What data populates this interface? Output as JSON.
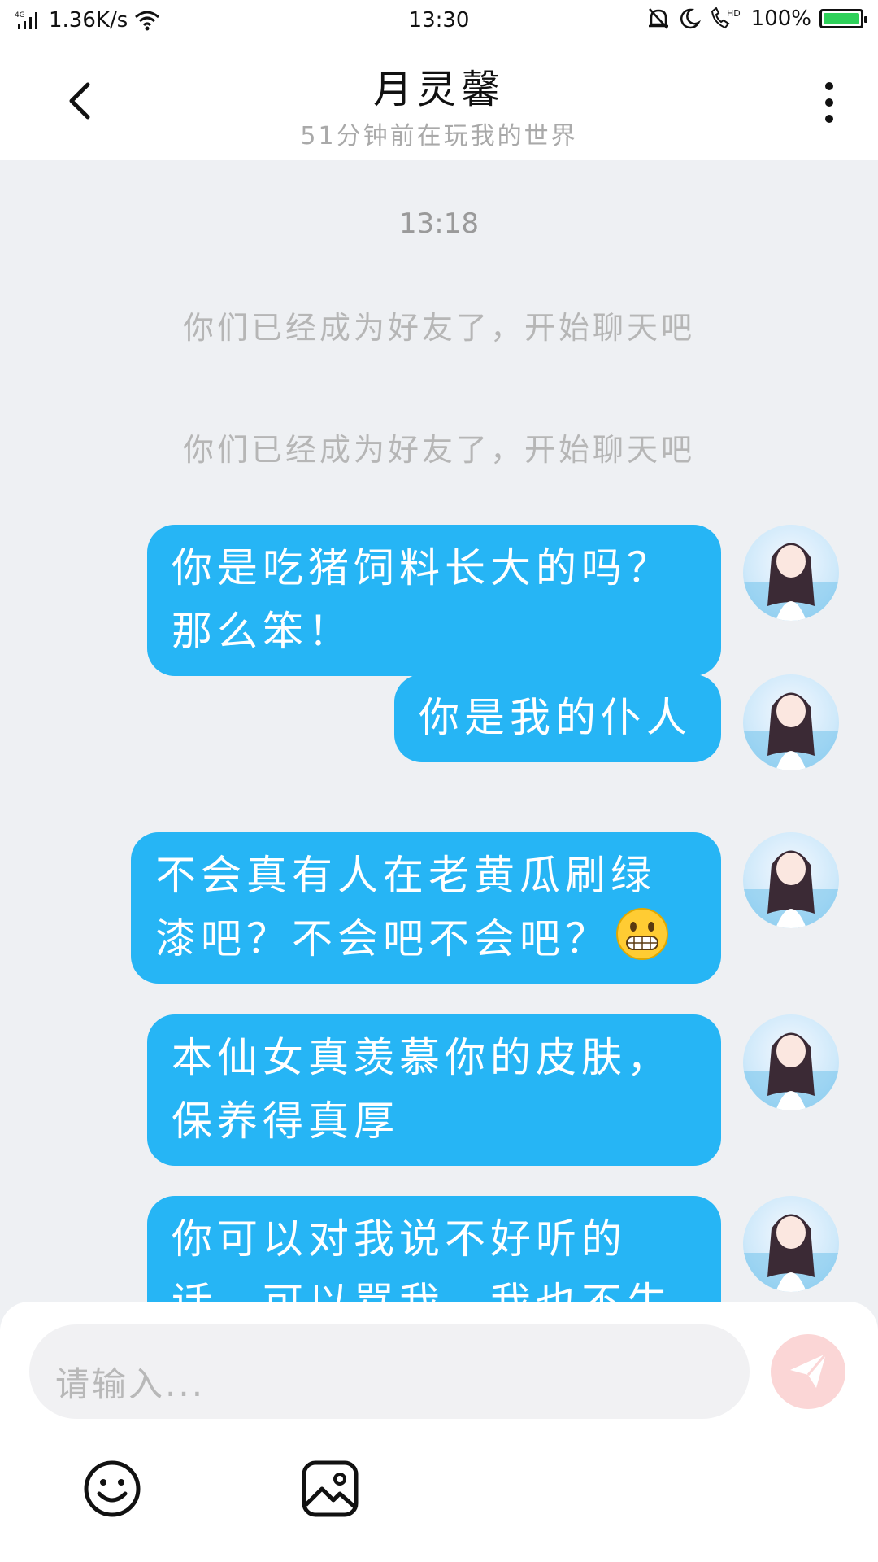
{
  "status_bar": {
    "network": "4G",
    "speed": "1.36K/s",
    "time": "13:30",
    "battery": "100%",
    "hd_label": "HD"
  },
  "header": {
    "title": "月灵馨",
    "subtitle": "51分钟前在玩我的世界"
  },
  "chat": {
    "time_label": "13:18",
    "system_messages": [
      "你们已经成为好友了，开始聊天吧",
      "你们已经成为好友了，开始聊天吧"
    ],
    "messages": [
      {
        "line1": "你是吃猪饲料长大的吗？",
        "line2": "那么笨！"
      },
      {
        "line1": "你是我的仆人"
      },
      {
        "line1": "不会真有人在老黄瓜刷绿",
        "line2": "漆吧？不会吧不会吧？"
      },
      {
        "line1": "本仙女真羡慕你的皮肤，",
        "line2": "保养得真厚"
      },
      {
        "line1": "你可以对我说不好听的",
        "line2": "话，可以骂我，我也不生"
      }
    ]
  },
  "composer": {
    "placeholder": "请输入..."
  },
  "colors": {
    "bubble": "#26b5f5",
    "background": "#eef0f3",
    "send": "#fbd6d6",
    "battery": "#2ed15a"
  },
  "icons": [
    "back-arrow-icon",
    "more-vertical-icon",
    "send-icon",
    "emoji-icon",
    "image-icon",
    "wifi-icon",
    "signal-icon",
    "bell-off-icon",
    "moon-icon",
    "phone-hd-icon",
    "battery-icon"
  ]
}
